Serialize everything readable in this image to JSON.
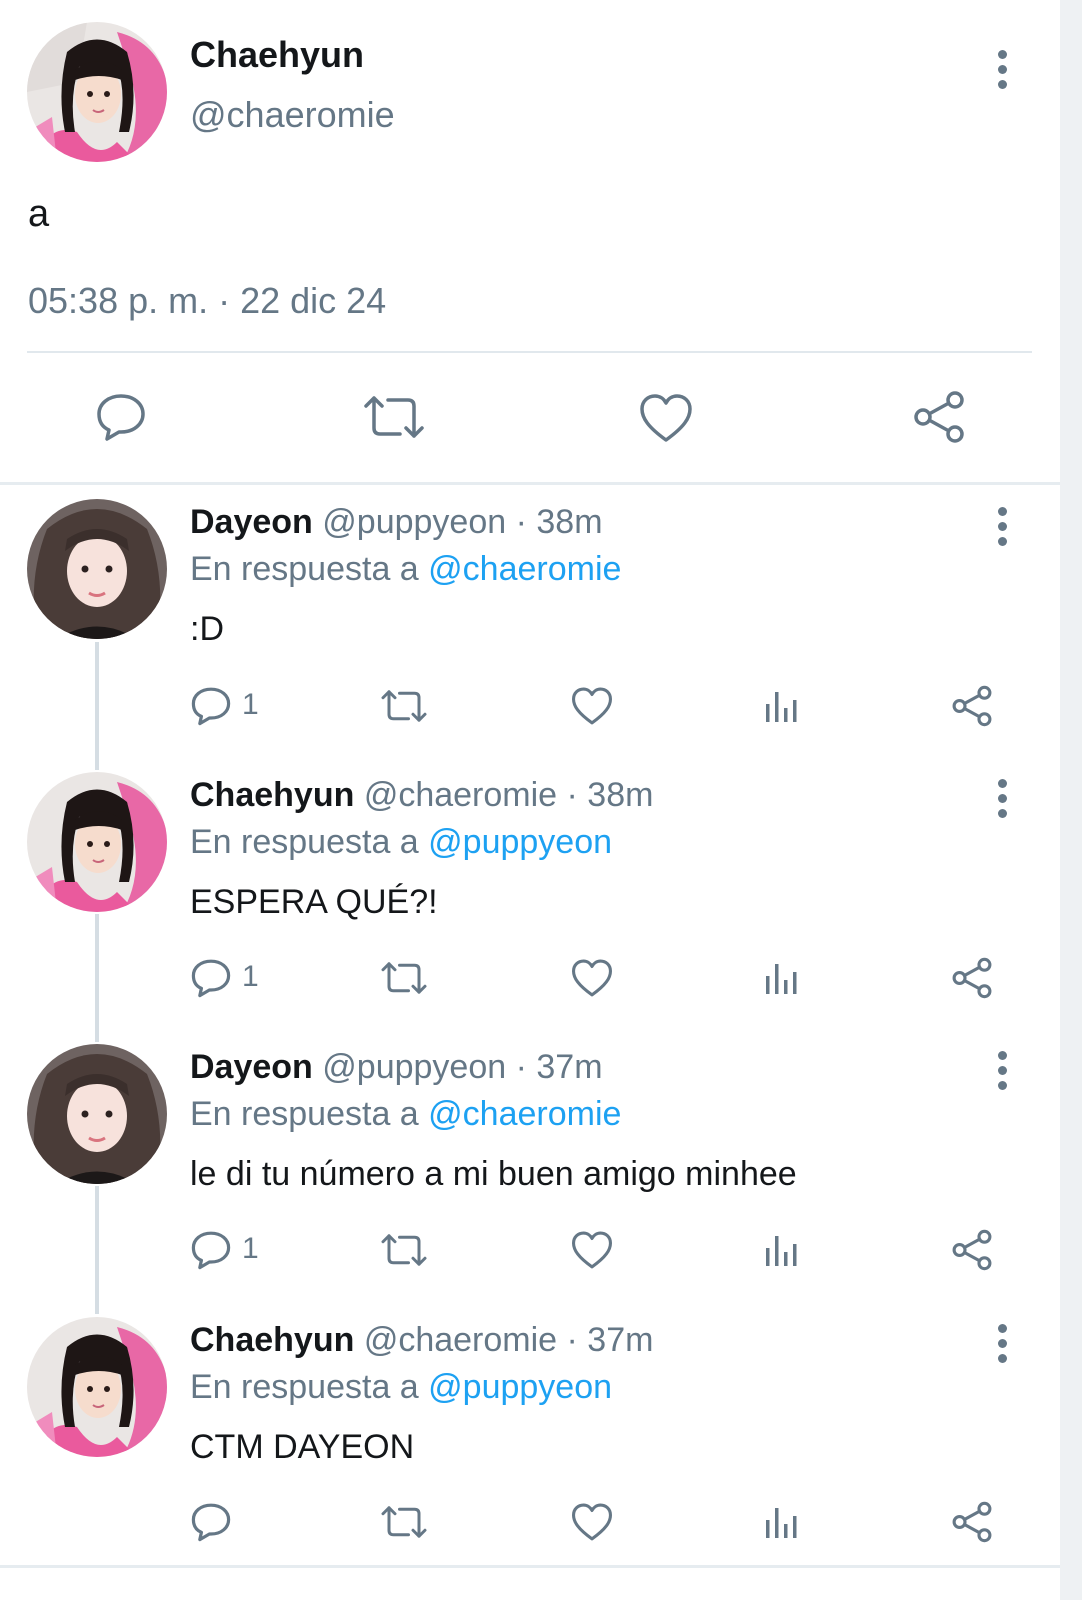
{
  "main_tweet": {
    "name": "Chaehyun",
    "handle": "@chaeromie",
    "text": "a",
    "timestamp": "05:38 p. m. · 22 dic 24",
    "actions": [
      "reply-icon",
      "retweet-icon",
      "like-icon",
      "share-icon"
    ]
  },
  "replies": [
    {
      "name": "Dayeon",
      "meta": "@puppyeon · 38m",
      "reply_prefix": "En respuesta a",
      "reply_to": "@chaeromie",
      "text": ":D",
      "reply_count": "1",
      "avatar": "dayeon"
    },
    {
      "name": "Chaehyun",
      "meta": "@chaeromie · 38m",
      "reply_prefix": "En respuesta a",
      "reply_to": "@puppyeon",
      "text": "ESPERA QUÉ?!",
      "reply_count": "1",
      "avatar": "chaehyun"
    },
    {
      "name": "Dayeon",
      "meta": "@puppyeon · 37m",
      "reply_prefix": "En respuesta a",
      "reply_to": "@chaeromie",
      "text": "le di tu número a mi buen amigo minhee",
      "reply_count": "1",
      "avatar": "dayeon"
    },
    {
      "name": "Chaehyun",
      "meta": "@chaeromie · 37m",
      "reply_prefix": "En respuesta a",
      "reply_to": "@puppyeon",
      "text": "CTM DAYEON",
      "reply_count": "",
      "avatar": "chaehyun"
    }
  ],
  "colors": {
    "accent": "#1da1f2",
    "muted": "#657786",
    "text": "#14171a",
    "divider": "#e1e8ed"
  }
}
